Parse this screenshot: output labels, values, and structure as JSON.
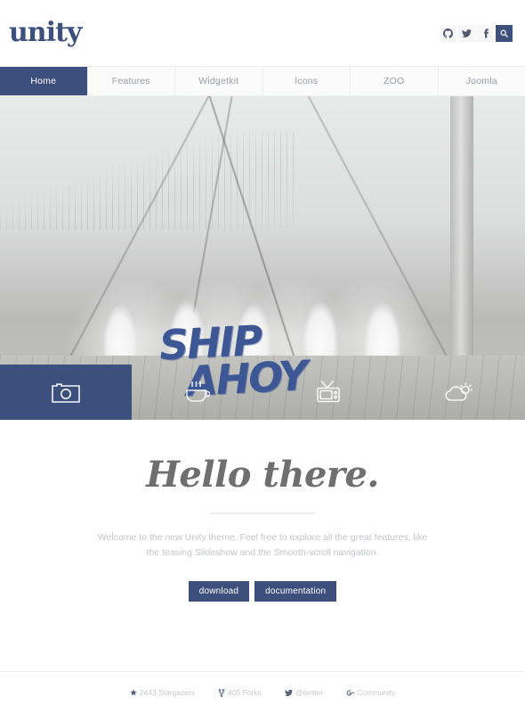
{
  "header": {
    "logo": "unity",
    "social": [
      {
        "name": "github-icon",
        "label": "GitHub"
      },
      {
        "name": "twitter-icon",
        "label": "Twitter"
      },
      {
        "name": "facebook-icon",
        "label": "Facebook"
      },
      {
        "name": "search-icon",
        "label": "Search"
      }
    ]
  },
  "nav": {
    "items": [
      {
        "label": "Home",
        "active": true
      },
      {
        "label": "Features",
        "active": false
      },
      {
        "label": "Widgetkit",
        "active": false
      },
      {
        "label": "Icons",
        "active": false
      },
      {
        "label": "ZOO",
        "active": false
      },
      {
        "label": "Joomla",
        "active": false
      }
    ]
  },
  "hero": {
    "title_line1": "SHIP",
    "title_line2": "AHOY",
    "title_color": "#3d5694",
    "slides": [
      {
        "icon": "camera-icon",
        "label": "Photo slide",
        "active": true
      },
      {
        "icon": "coffee-cup-icon",
        "label": "Coffee slide",
        "active": false
      },
      {
        "icon": "television-icon",
        "label": "TV slide",
        "active": false
      },
      {
        "icon": "cloud-sun-icon",
        "label": "Weather slide",
        "active": false
      }
    ]
  },
  "intro": {
    "heading": "Hello there.",
    "text": "Welcome to the new Unity theme. Feel free to explore all the great features, like the teasing Slideshow and the Smooth-scroll navigation.",
    "buttons": [
      {
        "label": "download"
      },
      {
        "label": "documentation"
      }
    ]
  },
  "footer": {
    "items": [
      {
        "icon": "star-icon",
        "label": "2443 Stargazers"
      },
      {
        "icon": "fork-icon",
        "label": "405 Forks"
      },
      {
        "icon": "twitter-icon",
        "label": "@twitter"
      },
      {
        "icon": "google-plus-icon",
        "label": "Community"
      }
    ]
  },
  "colors": {
    "accent": "#3d4f7d",
    "nav_inactive_text": "#9a9da6",
    "body_text": "#c5c7cc",
    "heading": "#6f6f6f"
  }
}
